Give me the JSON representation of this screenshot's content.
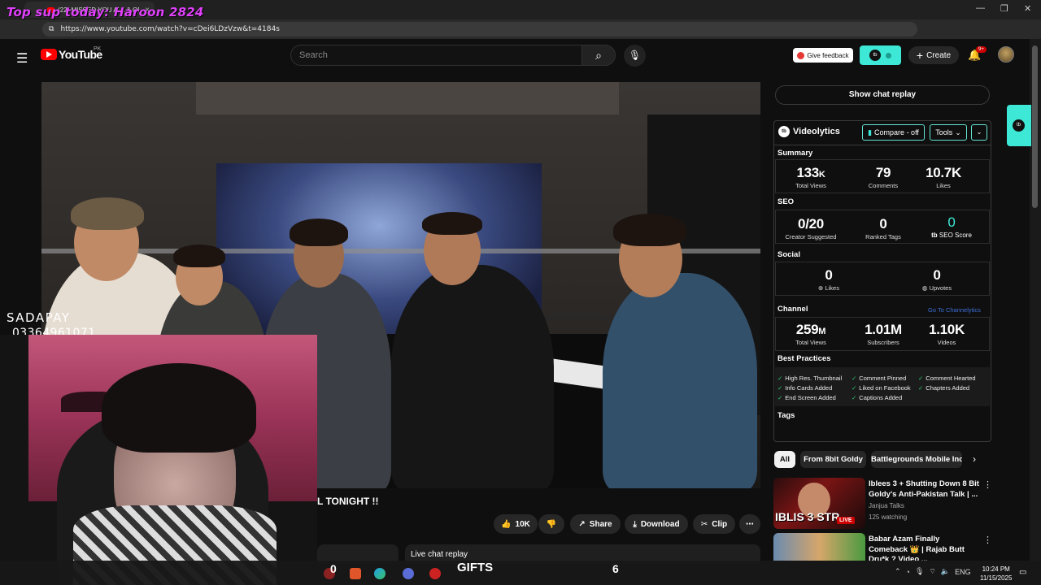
{
  "browser": {
    "tab_title": "(22) MISSED YOU ALL & OP",
    "tab_close": "×",
    "url": "https://www.youtube.com/watch?v=cDei6LDzVzw&t=4184s",
    "overlay_text": "Top sup today: Haroon 2824"
  },
  "youtube": {
    "logo_text": "YouTube",
    "country": "PK",
    "search_placeholder": "Search",
    "give_feedback": "Give feedback",
    "create_label": "Create",
    "notifications_badge": "9+"
  },
  "video": {
    "title_visible": "L TONIGHT !!",
    "likes": "10K",
    "share": "Share",
    "download": "Download",
    "clip": "Clip",
    "live_chat_replay": "Live chat replay"
  },
  "stream_overlay": {
    "sponsor": "SADAPAY",
    "phone": "03364961071",
    "gifts_left": "0",
    "gifts_label": "GIFTS",
    "gifts_right": "6"
  },
  "chat": {
    "show_chat_replay": "Show chat replay"
  },
  "videolytics": {
    "title": "Videolytics",
    "compare": "Compare - off",
    "tools": "Tools",
    "summary_label": "Summary",
    "summary": [
      {
        "value": "133",
        "suffix": "K",
        "label": "Total Views"
      },
      {
        "value": "79",
        "suffix": "",
        "label": "Comments"
      },
      {
        "value": "10.7K",
        "suffix": "",
        "label": "Likes"
      }
    ],
    "seo_label": "SEO",
    "seo": [
      {
        "value": "0/20",
        "label": "Creator Suggested"
      },
      {
        "value": "0",
        "label": "Ranked Tags"
      },
      {
        "value": "0",
        "label": "SEO Score"
      }
    ],
    "social_label": "Social",
    "social": [
      {
        "value": "0",
        "label": "Likes"
      },
      {
        "value": "0",
        "label": "Upvotes"
      }
    ],
    "channel_label": "Channel",
    "channel_link": "Go To Channelytics",
    "channel": [
      {
        "value": "259",
        "suffix": "M",
        "label": "Total Views"
      },
      {
        "value": "1.01M",
        "suffix": "",
        "label": "Subscribers"
      },
      {
        "value": "1.10K",
        "suffix": "",
        "label": "Videos"
      }
    ],
    "best_practices_label": "Best Practices",
    "best_practices": [
      "High Res. Thumbnail",
      "Comment Pinned",
      "Comment Hearted",
      "Info Cards Added",
      "Liked on Facebook",
      "Chapters Added",
      "End Screen Added",
      "Captions Added"
    ],
    "tags_label": "Tags",
    "accent": "#3ee8d6"
  },
  "chips": [
    "All",
    "From 8bit Goldy",
    "Battlegrounds Mobile India"
  ],
  "recommendations": [
    {
      "title": "Iblees 3 + Shutting Down 8 Bit Goldy's Anti-Pakistan Talk | ...",
      "channel": "Janjua Talks",
      "meta": "125 watching",
      "badge": "LIVE",
      "thumb_text": "IBLIS 3 STR"
    },
    {
      "title": "Babar Azam Finally Comeback 👑 | Rajab Butt Dru*k ? Video ...",
      "channel": "",
      "meta": "",
      "badge": "",
      "thumb_text": ""
    }
  ],
  "taskbar": {
    "language": "ENG",
    "time": "10:24 PM",
    "date": "11/15/2025"
  }
}
